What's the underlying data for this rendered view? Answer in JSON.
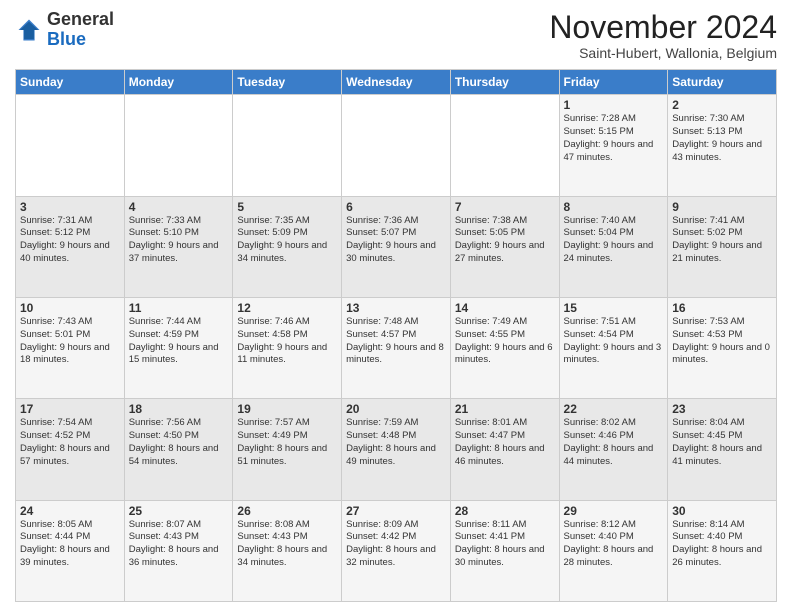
{
  "logo": {
    "general": "General",
    "blue": "Blue"
  },
  "header": {
    "title": "November 2024",
    "subtitle": "Saint-Hubert, Wallonia, Belgium"
  },
  "weekdays": [
    "Sunday",
    "Monday",
    "Tuesday",
    "Wednesday",
    "Thursday",
    "Friday",
    "Saturday"
  ],
  "weeks": [
    [
      {
        "day": "",
        "info": ""
      },
      {
        "day": "",
        "info": ""
      },
      {
        "day": "",
        "info": ""
      },
      {
        "day": "",
        "info": ""
      },
      {
        "day": "",
        "info": ""
      },
      {
        "day": "1",
        "info": "Sunrise: 7:28 AM\nSunset: 5:15 PM\nDaylight: 9 hours\nand 47 minutes."
      },
      {
        "day": "2",
        "info": "Sunrise: 7:30 AM\nSunset: 5:13 PM\nDaylight: 9 hours\nand 43 minutes."
      }
    ],
    [
      {
        "day": "3",
        "info": "Sunrise: 7:31 AM\nSunset: 5:12 PM\nDaylight: 9 hours\nand 40 minutes."
      },
      {
        "day": "4",
        "info": "Sunrise: 7:33 AM\nSunset: 5:10 PM\nDaylight: 9 hours\nand 37 minutes."
      },
      {
        "day": "5",
        "info": "Sunrise: 7:35 AM\nSunset: 5:09 PM\nDaylight: 9 hours\nand 34 minutes."
      },
      {
        "day": "6",
        "info": "Sunrise: 7:36 AM\nSunset: 5:07 PM\nDaylight: 9 hours\nand 30 minutes."
      },
      {
        "day": "7",
        "info": "Sunrise: 7:38 AM\nSunset: 5:05 PM\nDaylight: 9 hours\nand 27 minutes."
      },
      {
        "day": "8",
        "info": "Sunrise: 7:40 AM\nSunset: 5:04 PM\nDaylight: 9 hours\nand 24 minutes."
      },
      {
        "day": "9",
        "info": "Sunrise: 7:41 AM\nSunset: 5:02 PM\nDaylight: 9 hours\nand 21 minutes."
      }
    ],
    [
      {
        "day": "10",
        "info": "Sunrise: 7:43 AM\nSunset: 5:01 PM\nDaylight: 9 hours\nand 18 minutes."
      },
      {
        "day": "11",
        "info": "Sunrise: 7:44 AM\nSunset: 4:59 PM\nDaylight: 9 hours\nand 15 minutes."
      },
      {
        "day": "12",
        "info": "Sunrise: 7:46 AM\nSunset: 4:58 PM\nDaylight: 9 hours\nand 11 minutes."
      },
      {
        "day": "13",
        "info": "Sunrise: 7:48 AM\nSunset: 4:57 PM\nDaylight: 9 hours\nand 8 minutes."
      },
      {
        "day": "14",
        "info": "Sunrise: 7:49 AM\nSunset: 4:55 PM\nDaylight: 9 hours\nand 6 minutes."
      },
      {
        "day": "15",
        "info": "Sunrise: 7:51 AM\nSunset: 4:54 PM\nDaylight: 9 hours\nand 3 minutes."
      },
      {
        "day": "16",
        "info": "Sunrise: 7:53 AM\nSunset: 4:53 PM\nDaylight: 9 hours\nand 0 minutes."
      }
    ],
    [
      {
        "day": "17",
        "info": "Sunrise: 7:54 AM\nSunset: 4:52 PM\nDaylight: 8 hours\nand 57 minutes."
      },
      {
        "day": "18",
        "info": "Sunrise: 7:56 AM\nSunset: 4:50 PM\nDaylight: 8 hours\nand 54 minutes."
      },
      {
        "day": "19",
        "info": "Sunrise: 7:57 AM\nSunset: 4:49 PM\nDaylight: 8 hours\nand 51 minutes."
      },
      {
        "day": "20",
        "info": "Sunrise: 7:59 AM\nSunset: 4:48 PM\nDaylight: 8 hours\nand 49 minutes."
      },
      {
        "day": "21",
        "info": "Sunrise: 8:01 AM\nSunset: 4:47 PM\nDaylight: 8 hours\nand 46 minutes."
      },
      {
        "day": "22",
        "info": "Sunrise: 8:02 AM\nSunset: 4:46 PM\nDaylight: 8 hours\nand 44 minutes."
      },
      {
        "day": "23",
        "info": "Sunrise: 8:04 AM\nSunset: 4:45 PM\nDaylight: 8 hours\nand 41 minutes."
      }
    ],
    [
      {
        "day": "24",
        "info": "Sunrise: 8:05 AM\nSunset: 4:44 PM\nDaylight: 8 hours\nand 39 minutes."
      },
      {
        "day": "25",
        "info": "Sunrise: 8:07 AM\nSunset: 4:43 PM\nDaylight: 8 hours\nand 36 minutes."
      },
      {
        "day": "26",
        "info": "Sunrise: 8:08 AM\nSunset: 4:43 PM\nDaylight: 8 hours\nand 34 minutes."
      },
      {
        "day": "27",
        "info": "Sunrise: 8:09 AM\nSunset: 4:42 PM\nDaylight: 8 hours\nand 32 minutes."
      },
      {
        "day": "28",
        "info": "Sunrise: 8:11 AM\nSunset: 4:41 PM\nDaylight: 8 hours\nand 30 minutes."
      },
      {
        "day": "29",
        "info": "Sunrise: 8:12 AM\nSunset: 4:40 PM\nDaylight: 8 hours\nand 28 minutes."
      },
      {
        "day": "30",
        "info": "Sunrise: 8:14 AM\nSunset: 4:40 PM\nDaylight: 8 hours\nand 26 minutes."
      }
    ]
  ]
}
